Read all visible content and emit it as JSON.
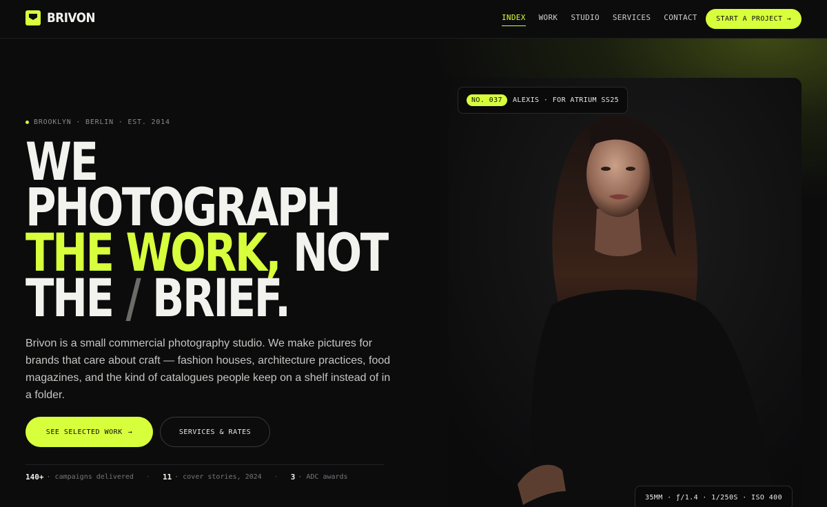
{
  "brand": {
    "name": "BRIVON",
    "logo_icon": "shield-square-icon"
  },
  "nav": {
    "items": [
      {
        "label": "INDEX",
        "active": true
      },
      {
        "label": "WORK",
        "active": false
      },
      {
        "label": "STUDIO",
        "active": false
      },
      {
        "label": "SERVICES",
        "active": false
      },
      {
        "label": "CONTACT",
        "active": false
      }
    ],
    "cta_label": "START A PROJECT",
    "cta_icon": "arrow-right-icon"
  },
  "hero": {
    "location": "BROOKLYN · BERLIN · EST. 2014",
    "headline": {
      "line1": "WE",
      "line2": "PHOTOGRAPH",
      "line3_accent": "THE WORK,",
      "line3_rest": " NOT",
      "line4_a": "THE ",
      "line4_slash": "/",
      "line4_b": " BRIEF."
    },
    "intro": "Brivon is a small commercial photography studio. We make pictures for brands that care about craft — fashion houses, architecture practices, food magazines, and the kind of catalogues people keep on a shelf instead of in a folder.",
    "primary_button": "SEE SELECTED WORK",
    "secondary_button": "SERVICES & RATES"
  },
  "stats": [
    {
      "value": "140+",
      "label": "campaigns delivered"
    },
    {
      "value": "11",
      "label": "cover stories, 2024"
    },
    {
      "value": "3",
      "label": "ADC awards"
    }
  ],
  "photo": {
    "badge_number": "NO. 037",
    "badge_caption": "ALEXIS · FOR ATRIUM SS25",
    "exif": "35MM · ƒ/1.4 · 1/250S · ISO 400"
  },
  "colors": {
    "accent": "#d8ff3c",
    "background": "#0c0c0d",
    "text": "#f2f2ee"
  }
}
